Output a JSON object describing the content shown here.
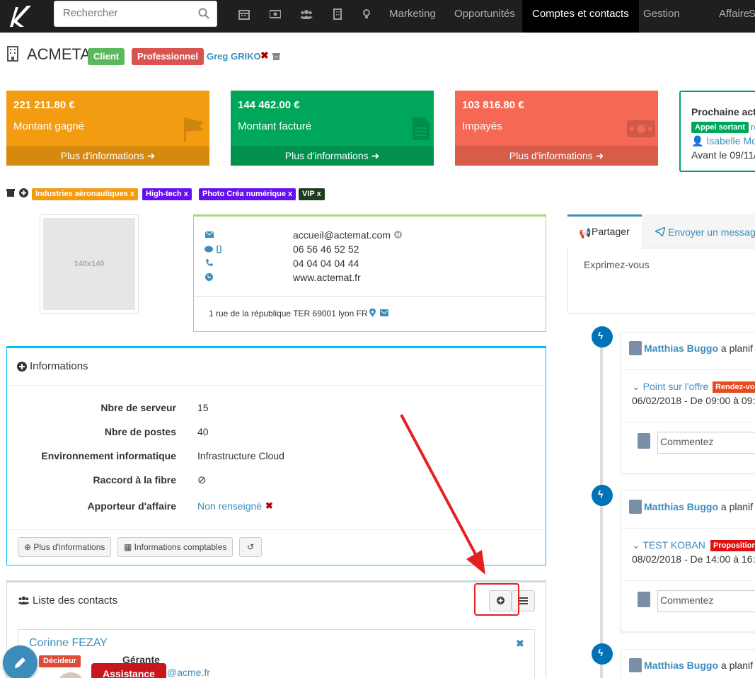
{
  "nav": {
    "search_placeholder": "Rechercher",
    "items": [
      "Marketing",
      "Opportunités",
      "Comptes et contacts",
      "Gestion",
      "Affaire",
      "S"
    ],
    "icons": [
      "calendar-icon",
      "money-icon",
      "users-icon",
      "building-icon",
      "lightbulb-icon"
    ]
  },
  "account": {
    "name": "ACMETA",
    "status_label": "Client",
    "type_label": "Professionnel",
    "owner": "Greg GRIKO"
  },
  "kpis": [
    {
      "amount": "221 211.80 €",
      "label": "Montant gagné",
      "more": "Plus d'informations",
      "color": "#f39c12"
    },
    {
      "amount": "144 462.00 €",
      "label": "Montant facturé",
      "more": "Plus d'informations",
      "color": "#00a65a"
    },
    {
      "amount": "103 816.80 €",
      "label": "Impayés",
      "more": "Plus d'informations",
      "color": "#f56954"
    }
  ],
  "next_action": {
    "title": "Prochaine act",
    "badge": "Appel sortant",
    "badge_suffix": "re",
    "person": "Isabelle Mou",
    "due": "Avant le 09/11/"
  },
  "tags": [
    {
      "label": "Industries aéronautiques x",
      "color": "#f39c12"
    },
    {
      "label": "High-tech x",
      "color": "#6610f2"
    },
    {
      "label": "Photo Créa numérique x",
      "color": "#6610f2"
    },
    {
      "label": "VIP x",
      "color": "#1a3a1a"
    }
  ],
  "avatar_placeholder": "140x140",
  "contact": {
    "email": "accueil@actemat.com",
    "mobile": "06 56 46 52 52",
    "phone": "04 04 04 04 44",
    "website": "www.actemat.fr",
    "address": "1 rue de la république TER 69001 lyon FR"
  },
  "informations": {
    "title": "Informations",
    "rows": [
      {
        "label": "Nbre de serveur",
        "value": "15"
      },
      {
        "label": "Nbre de postes",
        "value": "40"
      },
      {
        "label": "Environnement informatique",
        "value": "Infrastructure Cloud"
      },
      {
        "label": "Raccord à la fibre",
        "value": "⊘"
      },
      {
        "label": "Apporteur d'affaire",
        "value": "Non renseigné"
      }
    ],
    "btn_more": "Plus d'informations",
    "btn_compta": "Informations comptables"
  },
  "contacts": {
    "title": "Liste des contacts",
    "first_name": "Corinne FEZAY",
    "first_badge": "Décideur",
    "first_role": "Gérante",
    "first_email_partial": "@acme.fr",
    "assistance": "Assistance"
  },
  "share": {
    "tab_share": "Partager",
    "tab_message": "Envoyer un messag",
    "placeholder": "Exprimez-vous"
  },
  "feed": [
    {
      "author": "Matthias Buggo",
      "action": "a planif",
      "title": "Point sur l'offre",
      "badge": "Rendez-vo",
      "badge_color": "#e8491d",
      "when": "06/02/2018 - De 09:00 à 09:",
      "comment_placeholder": "Commentez"
    },
    {
      "author": "Matthias Buggo",
      "action": "a planif",
      "title": "TEST KOBAN",
      "badge": "Proposition",
      "badge_color": "#dd1111",
      "when": "08/02/2018 - De 14:00 à 16:",
      "comment_placeholder": "Commentez"
    },
    {
      "author": "Matthias Buggo",
      "action": "a planif"
    }
  ]
}
